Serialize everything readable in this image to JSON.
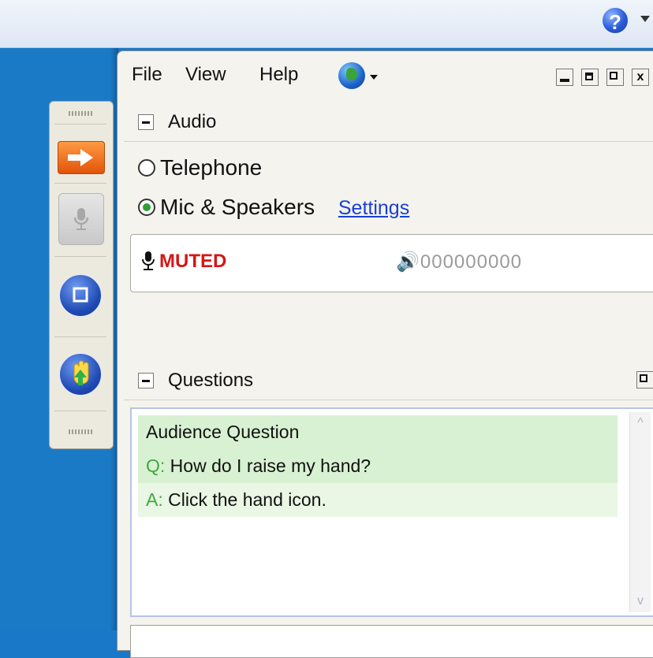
{
  "topbar": {
    "help_icon": "help-icon",
    "help_text": "?"
  },
  "toolbar": {
    "buttons": [
      {
        "name": "arrow-icon"
      },
      {
        "name": "microphone-icon"
      },
      {
        "name": "stop-icon"
      },
      {
        "name": "raise-hand-icon"
      }
    ]
  },
  "menu": {
    "file": "File",
    "view": "View",
    "help": "Help",
    "globe_icon": "globe-icon",
    "window_controls": {
      "close": "x"
    }
  },
  "audio": {
    "title": "Audio",
    "options": [
      {
        "label": "Telephone",
        "selected": false
      },
      {
        "label": "Mic & Speakers",
        "selected": true
      }
    ],
    "settings_link": "Settings",
    "status": "MUTED",
    "volume": "000000000"
  },
  "questions": {
    "title": "Questions",
    "header": "Audience Question",
    "question_prefix": "Q:",
    "question_text": " How do I raise my hand?",
    "answer_prefix": "A:",
    "answer_text": " Click the hand icon."
  },
  "colors": {
    "accent_blue": "#1a78c8",
    "muted_red": "#d51616",
    "qa_green": "#d8f1d2",
    "link_blue": "#1a3fd6"
  }
}
